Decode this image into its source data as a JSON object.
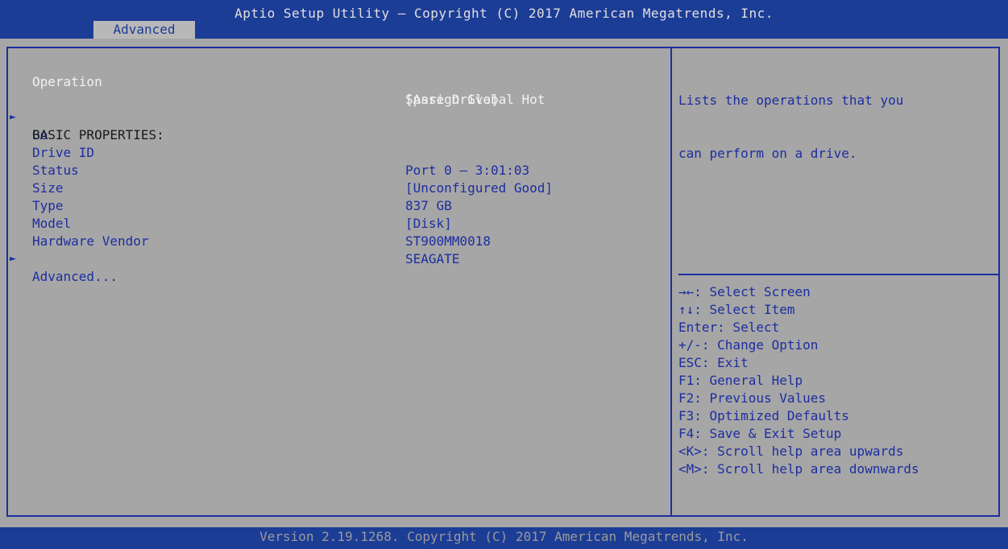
{
  "header": {
    "title": "Aptio Setup Utility – Copyright (C) 2017 American Megatrends, Inc.",
    "tab": "Advanced"
  },
  "settings": {
    "operation_label": "Operation",
    "operation_value_line1": "[Assign Global Hot",
    "operation_value_line2": "Spare Drive]",
    "go_label": "Go",
    "basic_heading": "BASIC PROPERTIES:",
    "properties": [
      {
        "label": "Drive ID",
        "value": "Port 0 – 3:01:03"
      },
      {
        "label": "Status",
        "value": "[Unconfigured Good]"
      },
      {
        "label": "Size",
        "value": "837 GB"
      },
      {
        "label": "Type",
        "value": "[Disk]"
      },
      {
        "label": "Model",
        "value": "ST900MM0018"
      },
      {
        "label": "Hardware Vendor",
        "value": "SEAGATE"
      }
    ],
    "advanced_label": "Advanced...",
    "submenu_marker": "►"
  },
  "help": {
    "line1": "Lists the operations that you",
    "line2": "can perform on a drive."
  },
  "keys": [
    "→←: Select Screen",
    "↑↓: Select Item",
    "Enter: Select",
    "+/-: Change Option",
    "ESC: Exit",
    "F1: General Help",
    "F2: Previous Values",
    "F3: Optimized Defaults",
    "F4: Save & Exit Setup",
    "<K>: Scroll help area upwards",
    "<M>: Scroll help area downwards"
  ],
  "footer": {
    "text": "Version 2.19.1268. Copyright (C) 2017 American Megatrends, Inc."
  },
  "colors": {
    "header_bg": "#1c3d96",
    "panel_bg": "#a6a6a6",
    "border": "#1c2ea0",
    "highlight_text": "#f2f2f2"
  }
}
